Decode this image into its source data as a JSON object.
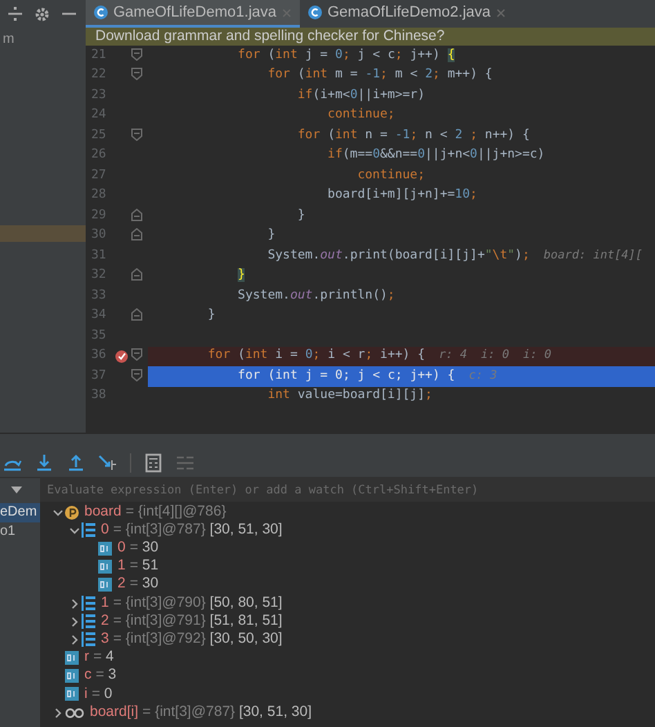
{
  "side_panel": {
    "label": "m"
  },
  "tabs": [
    {
      "label": "GameOfLifeDemo1.java",
      "selected": true
    },
    {
      "label": "GemaOfLifeDemo2.java",
      "selected": false
    }
  ],
  "banner": {
    "text": "Download grammar and spelling checker for Chinese?"
  },
  "code": [
    {
      "number": "21",
      "fold_start": true,
      "fold_end": false,
      "tokens": [
        {
          "kind": "kw",
          "text": "            for"
        },
        {
          "kind": "txt",
          "text": " ("
        },
        {
          "kind": "kw",
          "text": "int"
        },
        {
          "kind": "txt",
          "text": " j = "
        },
        {
          "kind": "num",
          "text": "0"
        },
        {
          "kind": "kw",
          "text": ";"
        },
        {
          "kind": "txt",
          "text": " j < c"
        },
        {
          "kind": "kw",
          "text": ";"
        },
        {
          "kind": "txt",
          "text": " j++) "
        },
        {
          "kind": "match",
          "text": "{"
        }
      ]
    },
    {
      "number": "22",
      "fold_start": true,
      "fold_end": false,
      "tokens": [
        {
          "kind": "kw",
          "text": "                for"
        },
        {
          "kind": "txt",
          "text": " ("
        },
        {
          "kind": "kw",
          "text": "int"
        },
        {
          "kind": "txt",
          "text": " m = "
        },
        {
          "kind": "num",
          "text": "-1"
        },
        {
          "kind": "kw",
          "text": ";"
        },
        {
          "kind": "txt",
          "text": " m < "
        },
        {
          "kind": "num",
          "text": "2"
        },
        {
          "kind": "kw",
          "text": ";"
        },
        {
          "kind": "txt",
          "text": " m++) {"
        }
      ]
    },
    {
      "number": "23",
      "fold_start": false,
      "fold_end": false,
      "tokens": [
        {
          "kind": "kw",
          "text": "                    if"
        },
        {
          "kind": "txt",
          "text": "(i+m<"
        },
        {
          "kind": "num",
          "text": "0"
        },
        {
          "kind": "txt",
          "text": "||i+m>=r)"
        }
      ]
    },
    {
      "number": "24",
      "fold_start": false,
      "fold_end": false,
      "tokens": [
        {
          "kind": "kw",
          "text": "                        continue;"
        }
      ]
    },
    {
      "number": "25",
      "fold_start": true,
      "fold_end": false,
      "tokens": [
        {
          "kind": "kw",
          "text": "                    for"
        },
        {
          "kind": "txt",
          "text": " ("
        },
        {
          "kind": "kw",
          "text": "int"
        },
        {
          "kind": "txt",
          "text": " n = "
        },
        {
          "kind": "num",
          "text": "-1"
        },
        {
          "kind": "kw",
          "text": ";"
        },
        {
          "kind": "txt",
          "text": " n < "
        },
        {
          "kind": "num",
          "text": "2"
        },
        {
          "kind": "kw",
          "text": " ;"
        },
        {
          "kind": "txt",
          "text": " n++) {"
        }
      ]
    },
    {
      "number": "26",
      "fold_start": false,
      "fold_end": false,
      "tokens": [
        {
          "kind": "kw",
          "text": "                        if"
        },
        {
          "kind": "txt",
          "text": "(m=="
        },
        {
          "kind": "num",
          "text": "0"
        },
        {
          "kind": "txt",
          "text": "&&n=="
        },
        {
          "kind": "num",
          "text": "0"
        },
        {
          "kind": "txt",
          "text": "||j+n<"
        },
        {
          "kind": "num",
          "text": "0"
        },
        {
          "kind": "txt",
          "text": "||j+n>=c)"
        }
      ]
    },
    {
      "number": "27",
      "fold_start": false,
      "fold_end": false,
      "tokens": [
        {
          "kind": "kw",
          "text": "                            continue;"
        }
      ]
    },
    {
      "number": "28",
      "fold_start": false,
      "fold_end": false,
      "tokens": [
        {
          "kind": "txt",
          "text": "                        board[i+m][j+n]+="
        },
        {
          "kind": "num",
          "text": "10"
        },
        {
          "kind": "kw",
          "text": ";"
        }
      ]
    },
    {
      "number": "29",
      "fold_start": false,
      "fold_end": true,
      "tokens": [
        {
          "kind": "txt",
          "text": "                    }"
        }
      ]
    },
    {
      "number": "30",
      "fold_start": false,
      "fold_end": true,
      "tokens": [
        {
          "kind": "txt",
          "text": "                }"
        }
      ]
    },
    {
      "number": "31",
      "fold_start": false,
      "fold_end": false,
      "tokens": [
        {
          "kind": "txt",
          "text": "                System."
        },
        {
          "kind": "field",
          "text": "out"
        },
        {
          "kind": "txt",
          "text": ".print(board[i][j]+"
        },
        {
          "kind": "str",
          "text": "\""
        },
        {
          "kind": "esc",
          "text": "\\t"
        },
        {
          "kind": "str",
          "text": "\""
        },
        {
          "kind": "txt",
          "text": ")"
        },
        {
          "kind": "kw",
          "text": ";"
        }
      ],
      "hints": [
        "board: int[4]["
      ]
    },
    {
      "number": "32",
      "fold_start": false,
      "fold_end": true,
      "tokens": [
        {
          "kind": "match",
          "text": "            }"
        }
      ]
    },
    {
      "number": "33",
      "fold_start": false,
      "fold_end": false,
      "tokens": [
        {
          "kind": "txt",
          "text": "            System."
        },
        {
          "kind": "field",
          "text": "out"
        },
        {
          "kind": "txt",
          "text": ".println()"
        },
        {
          "kind": "kw",
          "text": ";"
        }
      ]
    },
    {
      "number": "34",
      "fold_start": false,
      "fold_end": true,
      "tokens": [
        {
          "kind": "txt",
          "text": "        }"
        }
      ]
    },
    {
      "number": "35",
      "fold_start": false,
      "fold_end": false
    },
    {
      "number": "36",
      "fold_start": true,
      "fold_end": false,
      "breakpoint": true,
      "tokens": [
        {
          "kind": "kw",
          "text": "        for"
        },
        {
          "kind": "txt",
          "text": " ("
        },
        {
          "kind": "kw",
          "text": "int"
        },
        {
          "kind": "txt",
          "text": " i = "
        },
        {
          "kind": "num",
          "text": "0"
        },
        {
          "kind": "kw",
          "text": ";"
        },
        {
          "kind": "txt",
          "text": " i < r"
        },
        {
          "kind": "kw",
          "text": ";"
        },
        {
          "kind": "txt",
          "text": " i++) {"
        }
      ],
      "hints": [
        "r: 4",
        "i: 0",
        "i: 0"
      ]
    },
    {
      "number": "37",
      "fold_start": true,
      "fold_end": false,
      "current": true,
      "tokens": [
        {
          "kind": "kw",
          "text": "            for"
        },
        {
          "kind": "txt",
          "text": " ("
        },
        {
          "kind": "kw",
          "text": "int"
        },
        {
          "kind": "txt",
          "text": " j = "
        },
        {
          "kind": "num",
          "text": "0"
        },
        {
          "kind": "kw",
          "text": ";"
        },
        {
          "kind": "txt",
          "text": " j < c"
        },
        {
          "kind": "kw",
          "text": ";"
        },
        {
          "kind": "txt",
          "text": " j++) {"
        }
      ],
      "hints": [
        "c: 3"
      ]
    },
    {
      "number": "38",
      "fold_start": false,
      "fold_end": false,
      "tokens": [
        {
          "kind": "kw",
          "text": "                int"
        },
        {
          "kind": "txt",
          "text": " value=board[i][j]"
        },
        {
          "kind": "kw",
          "text": ";"
        }
      ]
    }
  ],
  "frames": [
    {
      "label": "eDem",
      "selected": true
    },
    {
      "label": "o1",
      "selected": false
    }
  ],
  "evaluate": {
    "placeholder": "Evaluate expression (Enter) or add a watch (Ctrl+Shift+Enter)"
  },
  "variables": [
    {
      "kind": "param",
      "name": "board",
      "detail": "= {int[4][]@786}",
      "expanded": true,
      "children": [
        {
          "kind": "array",
          "name": "0",
          "detail": "= {int[3]@787}",
          "value": "[30, 51, 30]",
          "expanded": true,
          "children": [
            {
              "kind": "prim",
              "name": "0",
              "detail": "=",
              "value": "30"
            },
            {
              "kind": "prim",
              "name": "1",
              "detail": "=",
              "value": "51"
            },
            {
              "kind": "prim",
              "name": "2",
              "detail": "=",
              "value": "30"
            }
          ]
        },
        {
          "kind": "array",
          "name": "1",
          "detail": "= {int[3]@790}",
          "value": "[50, 80, 51]",
          "expanded": false
        },
        {
          "kind": "array",
          "name": "2",
          "detail": "= {int[3]@791}",
          "value": "[51, 81, 51]",
          "expanded": false
        },
        {
          "kind": "array",
          "name": "3",
          "detail": "= {int[3]@792}",
          "value": "[30, 50, 30]",
          "expanded": false
        }
      ]
    },
    {
      "kind": "prim",
      "name": "r",
      "detail": "=",
      "value": "4"
    },
    {
      "kind": "prim",
      "name": "c",
      "detail": "=",
      "value": "3"
    },
    {
      "kind": "prim",
      "name": "i",
      "detail": "=",
      "value": "0"
    },
    {
      "kind": "watch",
      "name": "board[i]",
      "detail": "= {int[3]@787}",
      "value": "[30, 51, 30]",
      "expanded": false
    }
  ]
}
